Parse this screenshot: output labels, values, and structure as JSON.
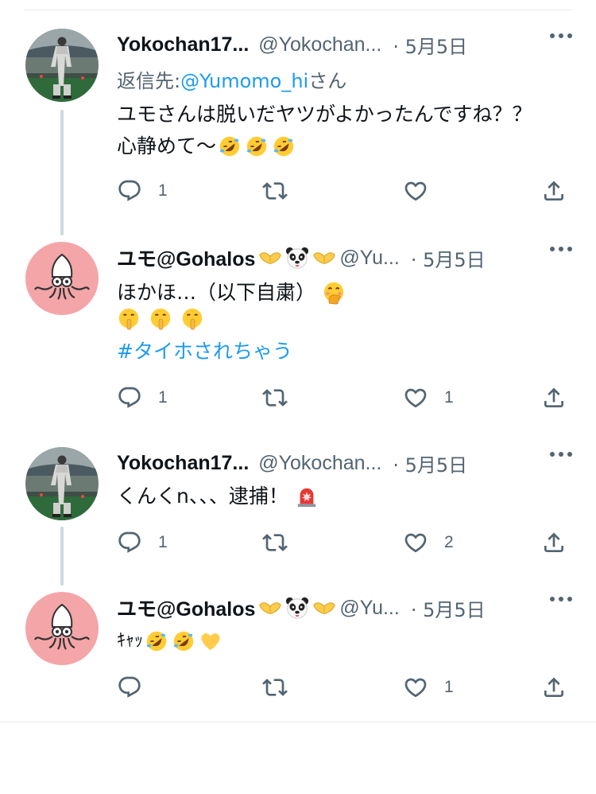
{
  "tweets": [
    {
      "name": "Yokochan17...",
      "handle": "@Yokochan...",
      "date": "· 5月5日",
      "reply_label": "返信先: ",
      "reply_handle": "@Yumomo_hi",
      "reply_suffix": "さん",
      "line1": "ユモさんは脱いだヤツがよかったんですね？？",
      "line2": "心静めて〜",
      "line2_emojis": [
        "rofl-emoji",
        "rofl-emoji",
        "rofl-emoji"
      ],
      "replies": "1",
      "retweets": "",
      "likes": ""
    },
    {
      "name": "ユモ@Gohalos",
      "handle": "@Yu...",
      "date": "· 5月5日",
      "badges": [
        "hands-emoji",
        "panda-emoji",
        "hands-emoji"
      ],
      "line1": "ほかほ…（以下自粛）",
      "line1_emojis": [
        "hand-over-mouth-emoji"
      ],
      "line2_emojis": [
        "shushing-emoji",
        "shushing-emoji",
        "shushing-emoji"
      ],
      "hashtag": "#タイホされちゃう",
      "replies": "1",
      "retweets": "",
      "likes": "1"
    },
    {
      "name": "Yokochan17...",
      "handle": "@Yokochan...",
      "date": "· 5月5日",
      "line1": "くんくn、、、逮捕！",
      "line1_emojis": [
        "siren-emoji"
      ],
      "replies": "1",
      "retweets": "",
      "likes": "2"
    },
    {
      "name": "ユモ@Gohalos",
      "handle": "@Yu...",
      "date": "· 5月5日",
      "badges": [
        "hands-emoji",
        "panda-emoji",
        "hands-emoji"
      ],
      "line1": "ｷｬｯ",
      "line1_emojis": [
        "rofl-emoji",
        "rofl-emoji",
        "yellow-heart-emoji"
      ],
      "replies": "",
      "retweets": "",
      "likes": "1"
    }
  ],
  "colors": {
    "link": "#1d9bf0",
    "secondary_text": "#536471",
    "thread_line": "#cfd9de",
    "avatar_pink": "#f4a5a8"
  }
}
